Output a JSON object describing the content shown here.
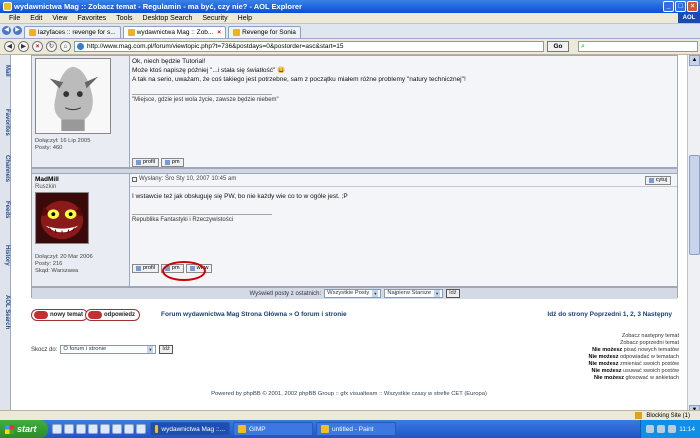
{
  "window": {
    "title": "wydawnictwa Mag :: Zobacz temat - Regulamin - ma być, czy nie? - AOL Explorer"
  },
  "menu": [
    "File",
    "Edit",
    "View",
    "Favorites",
    "Tools",
    "Desktop Search",
    "Security",
    "Help"
  ],
  "tabs": [
    {
      "label": "lazyfaces :: revenge for s...",
      "active": false
    },
    {
      "label": "wydawnictwa Mag :: Zob...",
      "active": true
    },
    {
      "label": "Revenge for Sonia",
      "active": false
    }
  ],
  "address": {
    "url": "http://www.mag.com.pl/forum/viewtopic.php?t=736&postdays=0&postorder=asc&start=15",
    "go_label": "Go"
  },
  "sidebar_tabs": [
    "Mail",
    "Favorites",
    "Channels",
    "Feeds",
    "History",
    "AOL Search"
  ],
  "posts": [
    {
      "joined": "Dołączył: 16 Lip 2005",
      "posts_count": "Posty: 460",
      "lines": [
        "Ok, niech będzie Tutorial!",
        "Może ktoś napiszę później \"...i stała się światłość\" 😀",
        "A tak na serio, uważam, że coś takiego jest potrzebne, sam z początku miałem różne problemy \"natury technicznej\"!"
      ],
      "signature": "\"Miejsce, gdzie jest wola życie, zawsze będzie niebem\"",
      "buttons": [
        "profil",
        "pm"
      ]
    },
    {
      "username": "MadMill",
      "rank": "Ruszkin",
      "header": "Wysłany: Śro Sty 10, 2007 10:45 am",
      "quote_label": "cytuj",
      "joined": "Dołączył: 20 Mar 2006",
      "posts_count": "Posty: 216",
      "location": "Skąd: Warszawa",
      "lines": [
        "I wstawcie też jak obsługuję się PW, bo nie każdy wie co to w ogóle jest. ;P"
      ],
      "signature": "Republika Fantastyki i Rzeczywistości",
      "buttons": [
        "profil",
        "pm",
        "www"
      ]
    }
  ],
  "view_options": {
    "label": "Wyświetl posty z ostatnich:",
    "range": "Wszystkie Posty",
    "order": "Najpierw Starsze",
    "go": "Idź"
  },
  "actions": {
    "new_topic": "nowy temat",
    "reply": "odpowiedz",
    "breadcrumb": "Forum wydawnictwa Mag Strona Główna » O forum i stronie",
    "pagination": "Idź do strony Poprzedni  1, 2, 3  Następny"
  },
  "jump": {
    "label": "Skocz do:",
    "selected": "O forum i stronie",
    "go": "Idź"
  },
  "topic_nav": [
    "Zobacz następny temat",
    "Zobacz poprzedni temat"
  ],
  "permissions": [
    {
      "bold": "Nie możesz",
      "rest": " pisać nowych tematów"
    },
    {
      "bold": "Nie możesz",
      "rest": " odpowiadać w tematach"
    },
    {
      "bold": "Nie możesz",
      "rest": " zmieniać swoich postów"
    },
    {
      "bold": "Nie możesz",
      "rest": " usuwać swoich postów"
    },
    {
      "bold": "Nie możesz",
      "rest": " głosować w ankietach"
    }
  ],
  "footer": "Powered by phpBB © 2001, 2002 phpBB Group :: gfx visualteam :: Wszystkie czasy w strefie CET (Europa)",
  "statusbar": {
    "blocking": "Blocking Site (1)"
  },
  "taskbar": {
    "start": "start",
    "tasks": [
      {
        "label": "wydawnictwa Mag ::...",
        "active": true
      },
      {
        "label": "GIMP",
        "active": false
      },
      {
        "label": "untitled - Paint",
        "active": false
      }
    ],
    "clock": "11:14"
  }
}
